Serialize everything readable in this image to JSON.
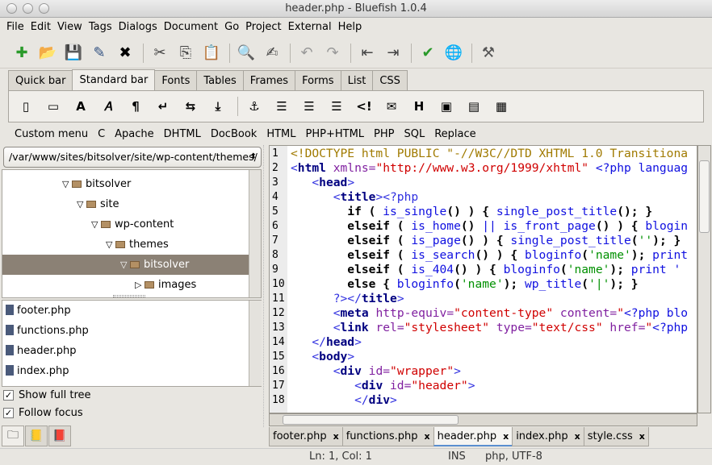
{
  "window": {
    "title": "header.php - Bluefish 1.0.4"
  },
  "menu": [
    "File",
    "Edit",
    "View",
    "Tags",
    "Dialogs",
    "Document",
    "Go",
    "Project",
    "External",
    "Help"
  ],
  "toolbar": [
    {
      "icon": "new-file-icon",
      "g": "✚",
      "c": "#2a9a2a"
    },
    {
      "icon": "open-folder-icon",
      "g": "📂",
      "c": "#a07020"
    },
    {
      "icon": "save-icon",
      "g": "💾",
      "c": "#305080"
    },
    {
      "icon": "save-as-icon",
      "g": "✎",
      "c": "#305080"
    },
    {
      "icon": "close-icon",
      "g": "✖",
      "c": "#000"
    },
    {
      "sep": true
    },
    {
      "icon": "cut-icon",
      "g": "✂",
      "c": "#444"
    },
    {
      "icon": "copy-icon",
      "g": "⎘",
      "c": "#444"
    },
    {
      "icon": "paste-icon",
      "g": "📋",
      "c": "#806030"
    },
    {
      "sep": true
    },
    {
      "icon": "find-icon",
      "g": "🔍",
      "c": "#444"
    },
    {
      "icon": "replace-icon",
      "g": "✍",
      "c": "#444"
    },
    {
      "sep": true
    },
    {
      "icon": "undo-icon",
      "g": "↶",
      "c": "#999"
    },
    {
      "icon": "redo-icon",
      "g": "↷",
      "c": "#999"
    },
    {
      "sep": true
    },
    {
      "icon": "unindent-icon",
      "g": "⇤",
      "c": "#444"
    },
    {
      "icon": "indent-icon",
      "g": "⇥",
      "c": "#444"
    },
    {
      "sep": true
    },
    {
      "icon": "spellcheck-icon",
      "g": "✔",
      "c": "#2a9a2a"
    },
    {
      "icon": "preview-browser-icon",
      "g": "🌐",
      "c": "#3060a0"
    },
    {
      "sep": true
    },
    {
      "icon": "preferences-icon",
      "g": "⚒",
      "c": "#555"
    }
  ],
  "tabs": [
    "Quick bar",
    "Standard bar",
    "Fonts",
    "Tables",
    "Frames",
    "Forms",
    "List",
    "CSS"
  ],
  "active_tab": 1,
  "htmlbar": [
    {
      "icon": "quickstart-icon",
      "g": "▯"
    },
    {
      "icon": "body-icon",
      "g": "▭"
    },
    {
      "icon": "bold-icon",
      "g": "A"
    },
    {
      "icon": "italic-icon",
      "g": "𝐴"
    },
    {
      "icon": "paragraph-icon",
      "g": "¶"
    },
    {
      "icon": "break-icon",
      "g": "↵"
    },
    {
      "icon": "break-clear-icon",
      "g": "⇆"
    },
    {
      "icon": "nbsp-icon",
      "g": "⤓"
    },
    {
      "sep": true
    },
    {
      "icon": "anchor-icon",
      "g": "⚓"
    },
    {
      "icon": "align-left-icon",
      "g": "☰"
    },
    {
      "icon": "align-center-icon",
      "g": "☰"
    },
    {
      "icon": "align-right-icon",
      "g": "☰"
    },
    {
      "icon": "comment-icon",
      "g": "&lt;!"
    },
    {
      "icon": "email-icon",
      "g": "✉"
    },
    {
      "icon": "heading-icon",
      "g": "H"
    },
    {
      "icon": "image-icon",
      "g": "▣"
    },
    {
      "icon": "thumbnail-icon",
      "g": "▤"
    },
    {
      "icon": "multi-thumbnail-icon",
      "g": "▦"
    }
  ],
  "custom_menu": [
    "Custom menu",
    "C",
    "Apache",
    "DHTML",
    "DocBook",
    "HTML",
    "PHP+HTML",
    "PHP",
    "SQL",
    "Replace"
  ],
  "sidebar": {
    "path": "/var/www/sites/bitsolver/site/wp-content/themes/",
    "tree": [
      {
        "label": "bitsolver",
        "level": 0,
        "open": true
      },
      {
        "label": "site",
        "level": 1,
        "open": true
      },
      {
        "label": "wp-content",
        "level": 2,
        "open": true
      },
      {
        "label": "themes",
        "level": 3,
        "open": true
      },
      {
        "label": "bitsolver",
        "level": 4,
        "open": true,
        "selected": true
      },
      {
        "label": "images",
        "level": 5,
        "open": false
      }
    ],
    "files": [
      "footer.php",
      "functions.php",
      "header.php",
      "index.php"
    ],
    "show_full_tree": {
      "label": "Show full tree",
      "checked": true
    },
    "follow_focus": {
      "label": "Follow focus",
      "checked": true
    }
  },
  "editor": {
    "lines": [
      [
        [
          "<!DOCTYPE html PUBLIC \"-//W3C//DTD XHTML 1.0 Transitiona",
          "dt"
        ]
      ],
      [
        [
          "<",
          "br"
        ],
        [
          "html",
          "tg"
        ],
        [
          " xmlns=",
          "at"
        ],
        [
          "\"http://www.w3.org/1999/xhtml\"",
          "st"
        ],
        [
          " <?php languag",
          "fn"
        ]
      ],
      [
        [
          "   <",
          "br"
        ],
        [
          "head",
          "tg"
        ],
        [
          ">",
          "br"
        ]
      ],
      [
        [
          "      <",
          "br"
        ],
        [
          "title",
          "tg"
        ],
        [
          "><?php",
          "br"
        ]
      ],
      [
        [
          "        if ( ",
          "kw"
        ],
        [
          "is_single",
          "fn"
        ],
        [
          "() ) { ",
          "kw"
        ],
        [
          "single_post_title",
          "fn"
        ],
        [
          "(); }",
          "kw"
        ]
      ],
      [
        [
          "        elseif ( ",
          "kw"
        ],
        [
          "is_home",
          "fn"
        ],
        [
          "() ",
          "kw"
        ],
        [
          "||",
          "fn"
        ],
        [
          " ",
          "kw"
        ],
        [
          "is_front_page",
          "fn"
        ],
        [
          "() ) { ",
          "kw"
        ],
        [
          "blogin",
          "fn"
        ]
      ],
      [
        [
          "        elseif ( ",
          "kw"
        ],
        [
          "is_page",
          "fn"
        ],
        [
          "() ) { ",
          "kw"
        ],
        [
          "single_post_title",
          "fn"
        ],
        [
          "(",
          "kw"
        ],
        [
          "''",
          "sq"
        ],
        [
          "); }",
          "kw"
        ]
      ],
      [
        [
          "        elseif ( ",
          "kw"
        ],
        [
          "is_search",
          "fn"
        ],
        [
          "() ) { ",
          "kw"
        ],
        [
          "bloginfo",
          "fn"
        ],
        [
          "(",
          "kw"
        ],
        [
          "'name'",
          "sq"
        ],
        [
          "); ",
          "kw"
        ],
        [
          "print",
          "fn"
        ]
      ],
      [
        [
          "        elseif ( ",
          "kw"
        ],
        [
          "is_404",
          "fn"
        ],
        [
          "() ) { ",
          "kw"
        ],
        [
          "bloginfo",
          "fn"
        ],
        [
          "(",
          "kw"
        ],
        [
          "'name'",
          "sq"
        ],
        [
          "); ",
          "kw"
        ],
        [
          "print '",
          "fn"
        ]
      ],
      [
        [
          "        else { ",
          "kw"
        ],
        [
          "bloginfo",
          "fn"
        ],
        [
          "(",
          "kw"
        ],
        [
          "'name'",
          "sq"
        ],
        [
          "); ",
          "kw"
        ],
        [
          "wp_title",
          "fn"
        ],
        [
          "(",
          "kw"
        ],
        [
          "'|'",
          "sq"
        ],
        [
          "); }",
          "kw"
        ]
      ],
      [
        [
          "      ?></",
          "br"
        ],
        [
          "title",
          "tg"
        ],
        [
          ">",
          "br"
        ]
      ],
      [
        [
          "      <",
          "br"
        ],
        [
          "meta",
          "tg"
        ],
        [
          " http-equiv=",
          "at"
        ],
        [
          "\"content-type\"",
          "st"
        ],
        [
          " content=",
          "at"
        ],
        [
          "\"",
          "st"
        ],
        [
          "<?php blo",
          "fn"
        ]
      ],
      [
        [
          "      <",
          "br"
        ],
        [
          "link",
          "tg"
        ],
        [
          " rel=",
          "at"
        ],
        [
          "\"stylesheet\"",
          "st"
        ],
        [
          " type=",
          "at"
        ],
        [
          "\"text/css\"",
          "st"
        ],
        [
          " href=",
          "at"
        ],
        [
          "\"",
          "st"
        ],
        [
          "<?php",
          "fn"
        ]
      ],
      [
        [
          "   </",
          "br"
        ],
        [
          "head",
          "tg"
        ],
        [
          ">",
          "br"
        ]
      ],
      [
        [
          "   <",
          "br"
        ],
        [
          "body",
          "tg"
        ],
        [
          ">",
          "br"
        ]
      ],
      [
        [
          "      <",
          "br"
        ],
        [
          "div",
          "tg"
        ],
        [
          " id=",
          "at"
        ],
        [
          "\"wrapper\"",
          "st"
        ],
        [
          ">",
          "br"
        ]
      ],
      [
        [
          "         <",
          "br"
        ],
        [
          "div",
          "tg"
        ],
        [
          " id=",
          "at"
        ],
        [
          "\"header\"",
          "st"
        ],
        [
          ">",
          "br"
        ]
      ],
      [
        [
          "         </",
          "br"
        ],
        [
          "div",
          "tg"
        ],
        [
          ">",
          "br"
        ]
      ]
    ]
  },
  "doc_tabs": [
    "footer.php",
    "functions.php",
    "header.php",
    "index.php",
    "style.css"
  ],
  "active_doc": 2,
  "status": {
    "position": "Ln: 1, Col: 1",
    "mode": "INS",
    "encoding": "php, UTF-8"
  }
}
